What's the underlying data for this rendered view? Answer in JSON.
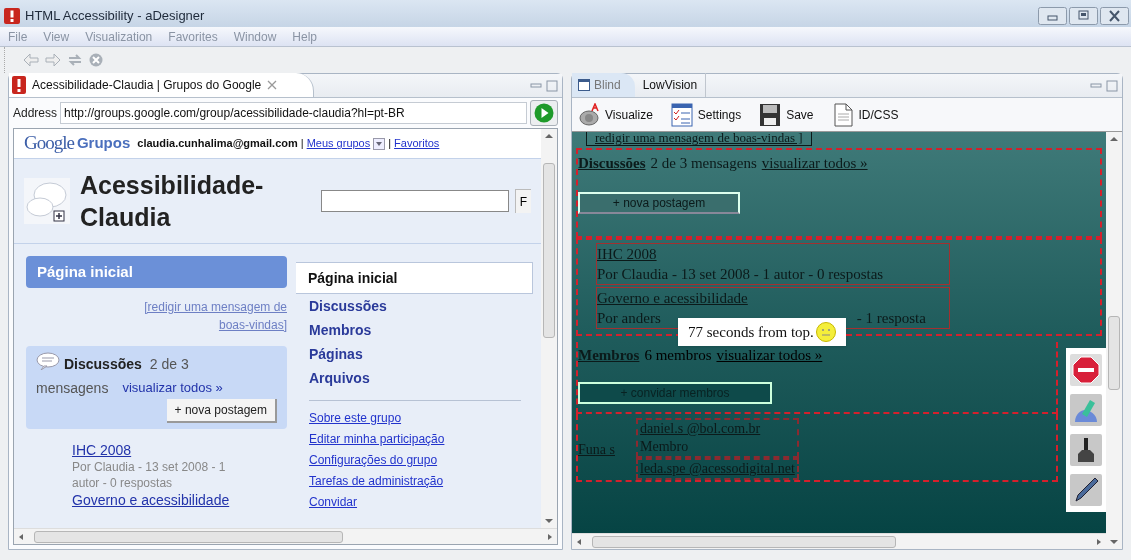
{
  "window": {
    "title": "HTML Accessibility - aDesigner"
  },
  "menu": [
    "File",
    "View",
    "Visualization",
    "Favorites",
    "Window",
    "Help"
  ],
  "browser": {
    "tab": "Acessibilidade-Claudia | Grupos do Google",
    "address_label": "Address",
    "address": "http://groups.google.com/group/acessibilidade-claudia?hl=pt-BR",
    "page": {
      "brand": "Google",
      "product": "Grupos",
      "email": "claudia.cunhalima@gmail.com",
      "separator_1": "|",
      "my_groups": "Meus grupos",
      "separator_2": "|",
      "favorites": "Favoritos",
      "group_title": "Acessibilidade-Claudia",
      "search_button": "F",
      "home_heading": "Página inicial",
      "welcome_link": "[redigir uma mensagem de boas-vindas]",
      "discussions": {
        "title": "Discussões",
        "count": "2 de 3",
        "count_line_2": "mensagens",
        "view_all": "visualizar todos »",
        "new_post": "+ nova postagem"
      },
      "topics": [
        {
          "title": "IHC 2008",
          "meta": "Por Claudia - 13 set 2008 - 1 autor - 0 respostas"
        },
        {
          "title": "Governo e acessibilidade"
        }
      ],
      "nav": [
        {
          "label": "Página inicial",
          "selected": true
        },
        {
          "label": "Discussões",
          "selected": false
        },
        {
          "label": "Membros",
          "selected": false
        },
        {
          "label": "Páginas",
          "selected": false
        },
        {
          "label": "Arquivos",
          "selected": false
        }
      ],
      "links": [
        "Sobre este grupo",
        "Editar minha participação",
        "Configurações do grupo",
        "Tarefas de administração",
        "Convidar"
      ]
    }
  },
  "blind": {
    "tabs": [
      {
        "label": "Blind",
        "selected": true
      },
      {
        "label": "LowVision",
        "selected": false
      }
    ],
    "tools": [
      {
        "kind": "visualize",
        "label": "Visualize"
      },
      {
        "kind": "settings",
        "label": "Settings"
      },
      {
        "kind": "save",
        "label": "Save"
      },
      {
        "kind": "idcss",
        "label": "ID/CSS"
      }
    ],
    "view": {
      "welcome": "redigir uma mensagem de boas-vindas ]",
      "discussions": "Discussões",
      "discussions_count": "2 de 3 mensagens",
      "discussions_all": "visualizar todos »",
      "new_post": "+ nova postagem",
      "topics": [
        {
          "title": "IHC 2008",
          "meta": "Por Claudia - 13 set 2008 - 1 autor - 0 respostas"
        },
        {
          "title": "Governo e acessibilidade",
          "meta_start": "Por anders",
          "meta_end": "- 1 resposta"
        }
      ],
      "tooltip": "77 seconds from top.",
      "members": "Membros",
      "members_count": "6 membros",
      "members_all": "visualizar todos »",
      "invite": "+ convidar membros",
      "member_label": "Funa s",
      "member_list": [
        {
          "email": "daniel.s @bol.com.br",
          "role": "Membro"
        },
        {
          "email": "leda.spe @acessodigital.net"
        }
      ]
    }
  }
}
